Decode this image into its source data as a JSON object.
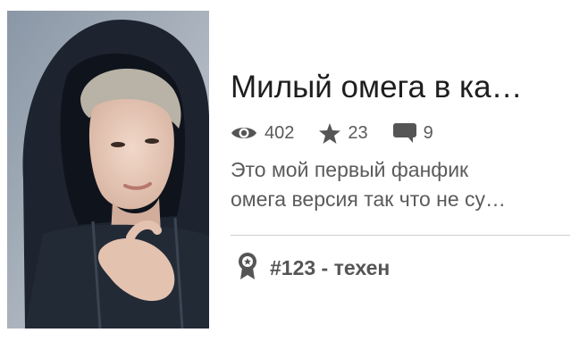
{
  "story": {
    "title": "Милый омега в ка…",
    "description_lines": [
      "Это мой первый фанфик",
      "омега версия так что не су…"
    ]
  },
  "stats": {
    "reads": "402",
    "votes": "23",
    "comments": "9"
  },
  "ranking": {
    "text": "#123 - техен"
  },
  "icons": {
    "reads": "eye-icon",
    "votes": "star-icon",
    "comments": "comment-bubble-icon",
    "ranking": "ribbon-badge-icon"
  },
  "colors": {
    "icon": "#555555",
    "text_primary": "#1e1e1e",
    "text_secondary": "#5b5b5b",
    "divider": "#cfcfcf"
  }
}
